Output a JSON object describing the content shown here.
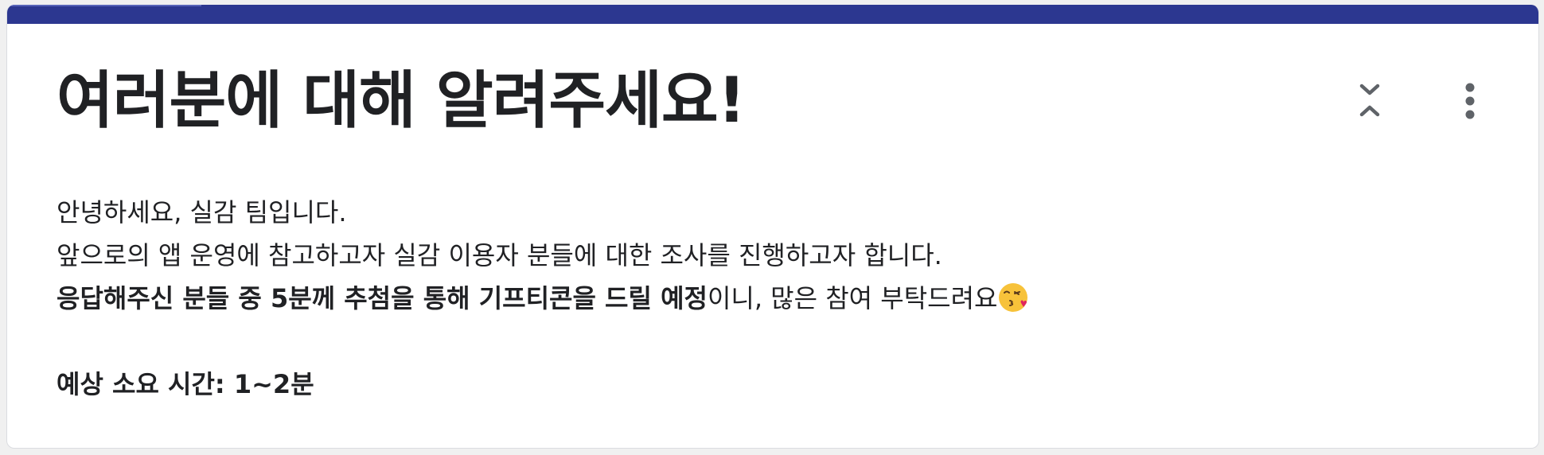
{
  "section": {
    "title": "여러분에 대해 알려주세요!",
    "description": {
      "line1": "안녕하세요, 실감 팀입니다.",
      "line2": "앞으로의 앱 운영에 참고하고자 실감 이용자 분들에 대한 조사를 진행하고자 합니다.",
      "line3_bold": "응답해주신 분들 중 5분께 추첨을 통해 기프티콘을 드릴 예정",
      "line3_rest": "이니, 많은 참여 부탁드려요",
      "line3_emoji": "face-blowing-kiss-icon",
      "time_estimate": "예상 소요 시간: 1~2분"
    }
  },
  "controls": {
    "collapse_icon": "collapse-icon",
    "more_icon": "more-vert-icon"
  },
  "colors": {
    "header_bar": "#2c3790",
    "text": "#202124",
    "icon": "#5f6368"
  }
}
